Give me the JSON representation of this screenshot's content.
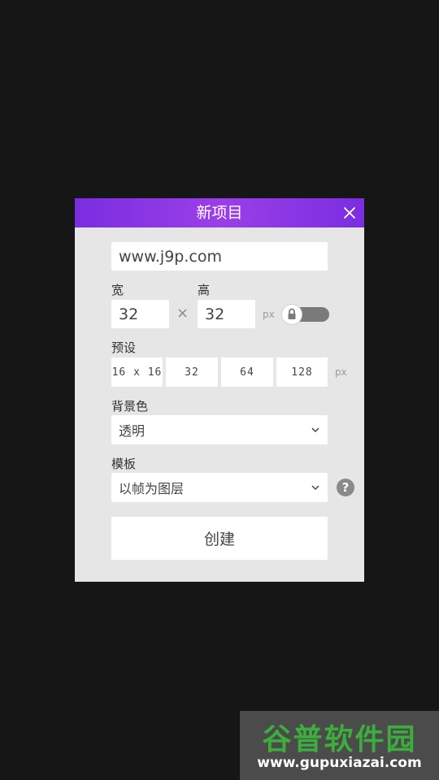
{
  "dialog": {
    "title": "新项目",
    "close_icon": "close-icon",
    "name_value": "www.j9p.com",
    "width_label": "宽",
    "height_label": "高",
    "width_value": "32",
    "height_value": "32",
    "times_symbol": "×",
    "unit_px": "px",
    "lock_icon": "lock-icon",
    "preset_label": "预设",
    "presets": [
      "16 x 16",
      "32",
      "64",
      "128"
    ],
    "preset_unit": "px",
    "background_label": "背景色",
    "background_value": "透明",
    "template_label": "模板",
    "template_value": "以帧为图层",
    "help_symbol": "?",
    "create_label": "创建"
  },
  "watermark": {
    "main_text": "谷普软件园",
    "sub_text": "www.gupuxiazai.com"
  },
  "colors": {
    "header_gradient": "#8a35e6",
    "dialog_background": "#e6e6e6",
    "screen_background": "#161616"
  }
}
